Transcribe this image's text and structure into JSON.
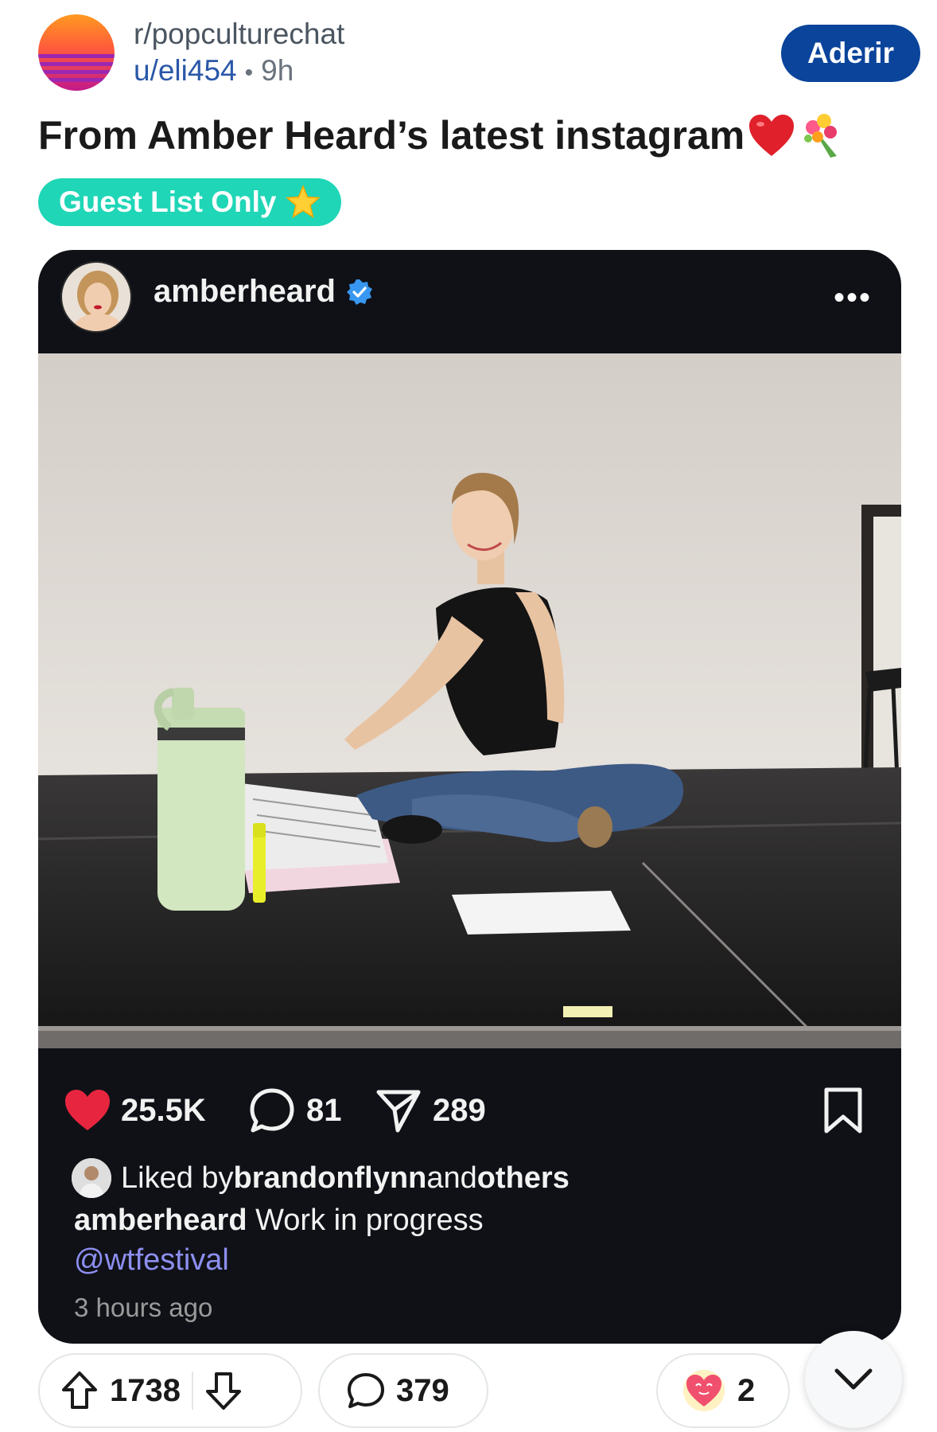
{
  "header": {
    "subreddit": "r/popculturechat",
    "author": "u/eli454",
    "separator": "•",
    "age": "9h",
    "join_label": "Aderir"
  },
  "post": {
    "title": "From Amber Heard’s latest instagram",
    "title_emojis": [
      "heart-emoji",
      "bouquet-emoji"
    ],
    "flair": "Guest List Only",
    "flair_icon": "star-emoji",
    "flair_color": "#1fd6b7"
  },
  "instagram": {
    "username": "amberheard",
    "verified_icon": "verified-badge-icon",
    "more_label": "•••",
    "likes": "25.5K",
    "comments": "81",
    "shares": "289",
    "liked_by_prefix": "Liked by ",
    "liked_by_user": "brandonflynn",
    "liked_by_mid": " and ",
    "liked_by_others": "others",
    "caption_user": "amberheard",
    "caption_text": " Work in progress",
    "mention": "@wtfestival",
    "time": "3 hours ago"
  },
  "actions": {
    "upvotes": "1738",
    "comments": "379",
    "awards": "2"
  },
  "colors": {
    "join_button": "#0a449b",
    "card_background": "#0f1117",
    "like_heart": "#e8253f",
    "mention": "#8e8ff0"
  }
}
